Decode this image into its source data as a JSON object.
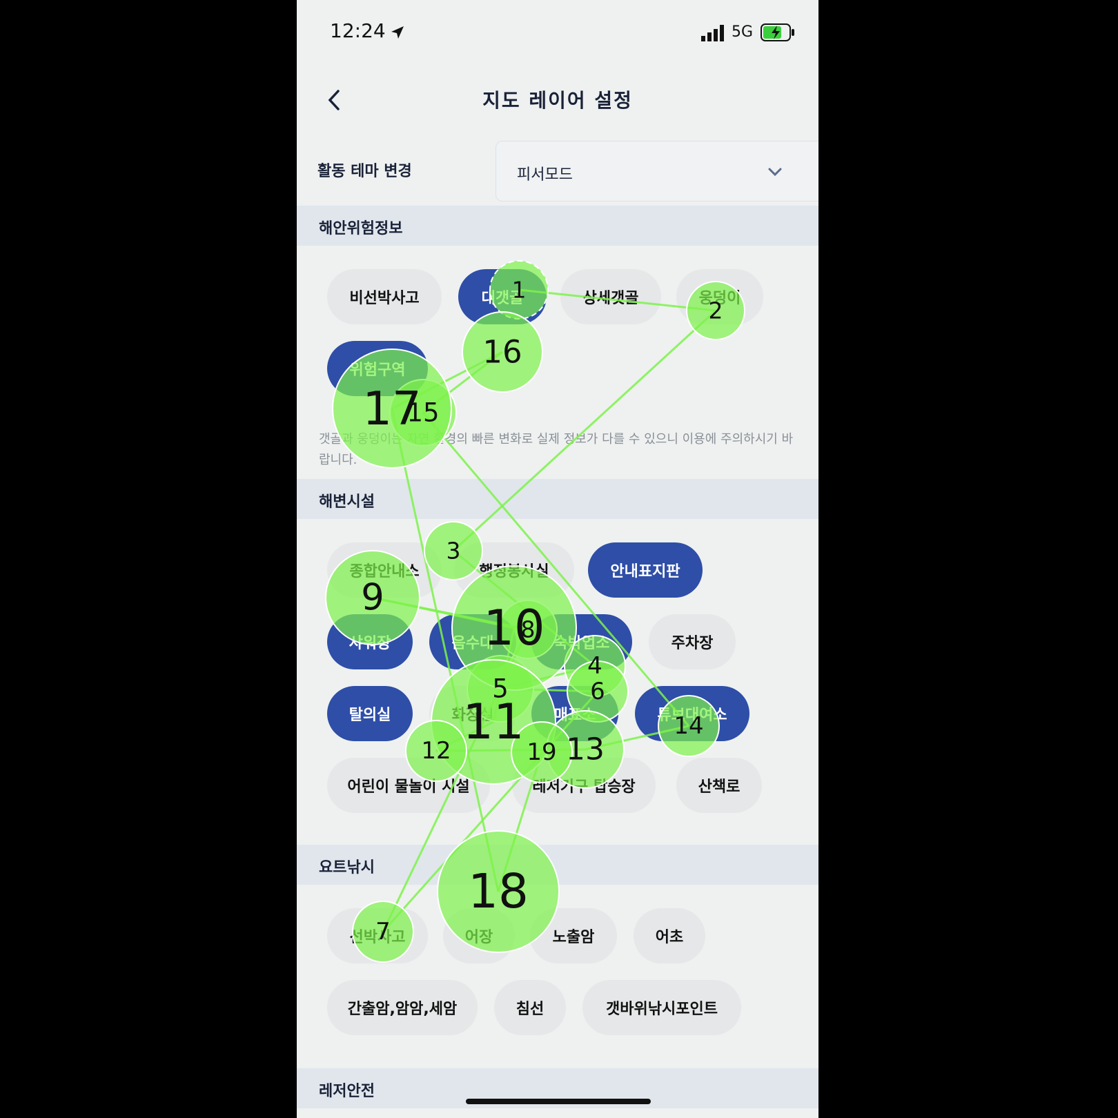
{
  "status": {
    "time": "12:24",
    "network": "5G"
  },
  "nav": {
    "title": "지도 레이어 설정"
  },
  "theme": {
    "label": "활동 테마 변경",
    "value": "피서모드"
  },
  "sections": [
    {
      "title": "해안위험정보",
      "chips": [
        {
          "label": "비선박사고",
          "active": false
        },
        {
          "label": "대갯골",
          "active": true
        },
        {
          "label": "상세갯골",
          "active": false
        },
        {
          "label": "웅덩이",
          "active": false
        },
        {
          "label": "위험구역",
          "active": true
        }
      ],
      "notice": "갯골과 웅덩이는 자연 환경의 빠른 변화로 실제 정보가 다를 수 있으니 이용에 주의하시기 바랍니다."
    },
    {
      "title": "해변시설",
      "chips": [
        {
          "label": "종합안내소",
          "active": false
        },
        {
          "label": "행정봉사실",
          "active": false
        },
        {
          "label": "안내표지판",
          "active": true
        },
        {
          "label": "샤워장",
          "active": true
        },
        {
          "label": "음수대",
          "active": true
        },
        {
          "label": "숙박업소",
          "active": true
        },
        {
          "label": "주차장",
          "active": false
        },
        {
          "label": "탈의실",
          "active": true
        },
        {
          "label": "화장실",
          "active": false
        },
        {
          "label": "매표소",
          "active": true
        },
        {
          "label": "튜브대여소",
          "active": true
        },
        {
          "label": "어린이 물놀이 시설",
          "active": false
        },
        {
          "label": "레저기구 탑승장",
          "active": false
        },
        {
          "label": "산책로",
          "active": false
        }
      ]
    },
    {
      "title": "요트낚시",
      "chips": [
        {
          "label": "선박사고",
          "active": false
        },
        {
          "label": "어장",
          "active": false
        },
        {
          "label": "노출암",
          "active": false
        },
        {
          "label": "어초",
          "active": false
        },
        {
          "label": "간출암,암암,세암",
          "active": false
        },
        {
          "label": "침선",
          "active": false
        },
        {
          "label": "갯바위낚시포인트",
          "active": false
        }
      ]
    },
    {
      "title": "레저안전"
    }
  ],
  "fixations": [
    {
      "n": "1",
      "r": 42
    },
    {
      "n": "2",
      "r": 42
    },
    {
      "n": "3",
      "r": 42
    },
    {
      "n": "4",
      "r": 44
    },
    {
      "n": "5",
      "r": 48
    },
    {
      "n": "6",
      "r": 44
    },
    {
      "n": "7",
      "r": 44
    },
    {
      "n": "8",
      "r": 42
    },
    {
      "n": "9",
      "r": 68
    },
    {
      "n": "10",
      "r": 90
    },
    {
      "n": "11",
      "r": 90
    },
    {
      "n": "12",
      "r": 44
    },
    {
      "n": "13",
      "r": 56
    },
    {
      "n": "14",
      "r": 44
    },
    {
      "n": "15",
      "r": 48
    },
    {
      "n": "16",
      "r": 58
    },
    {
      "n": "17",
      "r": 86
    },
    {
      "n": "18",
      "r": 88
    },
    {
      "n": "19",
      "r": 44
    }
  ],
  "colors": {
    "active_chip": "#2e4ea7",
    "inactive_chip": "#e5e7e8",
    "fixation": "#7df24a",
    "section_bg": "#e0e6ec"
  }
}
